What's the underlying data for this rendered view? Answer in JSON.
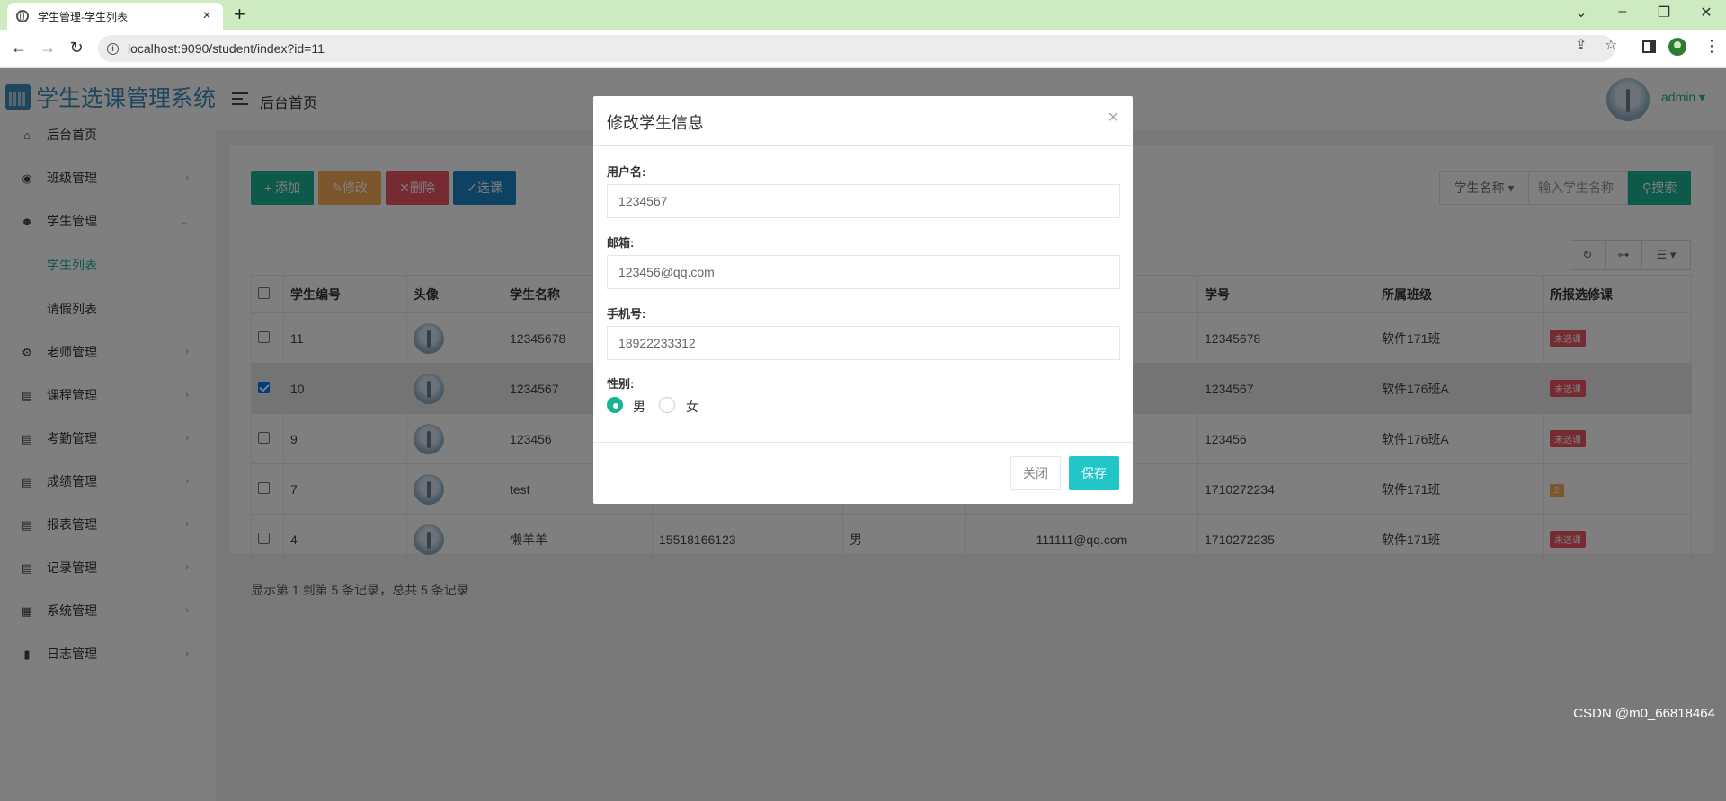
{
  "browser": {
    "tab_title": "学生管理-学生列表",
    "url": "localhost:9090/student/index?id=11"
  },
  "sidebar": {
    "logo_text": "学生选课管理系统",
    "items": [
      {
        "label": "后台首页",
        "icon": "home-icon"
      },
      {
        "label": "班级管理",
        "icon": "palette-icon"
      },
      {
        "label": "学生管理",
        "icon": "users-icon"
      },
      {
        "label": "学生列表",
        "icon": ""
      },
      {
        "label": "请假列表",
        "icon": ""
      },
      {
        "label": "老师管理",
        "icon": "user-gear-icon"
      },
      {
        "label": "课程管理",
        "icon": "file-icon"
      },
      {
        "label": "考勤管理",
        "icon": "file-text-icon"
      },
      {
        "label": "成绩管理",
        "icon": "file-check-icon"
      },
      {
        "label": "报表管理",
        "icon": "file-chart-icon"
      },
      {
        "label": "记录管理",
        "icon": "file-list-icon"
      },
      {
        "label": "系统管理",
        "icon": "grid-icon"
      },
      {
        "label": "日志管理",
        "icon": "book-icon"
      }
    ]
  },
  "header": {
    "title": "后台首页",
    "user": "admin"
  },
  "toolbar": {
    "add": "+ 添加",
    "edit": "修改",
    "delete": "删除",
    "select_course": "选课",
    "search_field": "学生名称",
    "search_placeholder": "输入学生名称",
    "search_btn": "搜索"
  },
  "table": {
    "headers": [
      "学生编号",
      "头像",
      "学生名称",
      "",
      "",
      "",
      "学号",
      "所属班级",
      "所报选修课"
    ],
    "rows": [
      {
        "id": "11",
        "name": "12345678",
        "phone": "",
        "gender": "",
        "email": "",
        "sno": "12345678",
        "class": "软件171班",
        "course": "未选课",
        "checked": false
      },
      {
        "id": "10",
        "name": "1234567",
        "phone": "",
        "gender": "",
        "email": "",
        "sno": "1234567",
        "class": "软件176班A",
        "course": "未选课",
        "checked": true
      },
      {
        "id": "9",
        "name": "123456",
        "phone": "",
        "gender": "",
        "email": "",
        "sno": "123456",
        "class": "软件176班A",
        "course": "未选课",
        "checked": false
      },
      {
        "id": "7",
        "name": "test",
        "phone": "",
        "gender": "",
        "email": "",
        "sno": "1710272234",
        "class": "软件171班",
        "course": "2",
        "checked": false
      },
      {
        "id": "4",
        "name": "懒羊羊",
        "phone": "15518166123",
        "gender": "男",
        "email": "111111@qq.com",
        "sno": "1710272235",
        "class": "软件171班",
        "course": "未选课",
        "checked": false
      }
    ],
    "footer": "显示第 1 到第 5 条记录，总共 5 条记录"
  },
  "modal": {
    "title": "修改学生信息",
    "username_label": "用户名:",
    "username_value": "1234567",
    "email_label": "邮箱:",
    "email_value": "123456@qq.com",
    "phone_label": "手机号:",
    "phone_value": "18922233312",
    "gender_label": "性别:",
    "gender_male": "男",
    "gender_female": "女",
    "close_btn": "关闭",
    "save_btn": "保存"
  },
  "watermark": "CSDN @m0_66818464",
  "colors": {
    "accent": "#1ab394",
    "warning": "#f8ac59",
    "danger": "#ed5565",
    "info": "#23c6c8",
    "primary": "#1c84c6",
    "badge_red": "#ed5565",
    "badge_orange": "#f8ac59"
  }
}
